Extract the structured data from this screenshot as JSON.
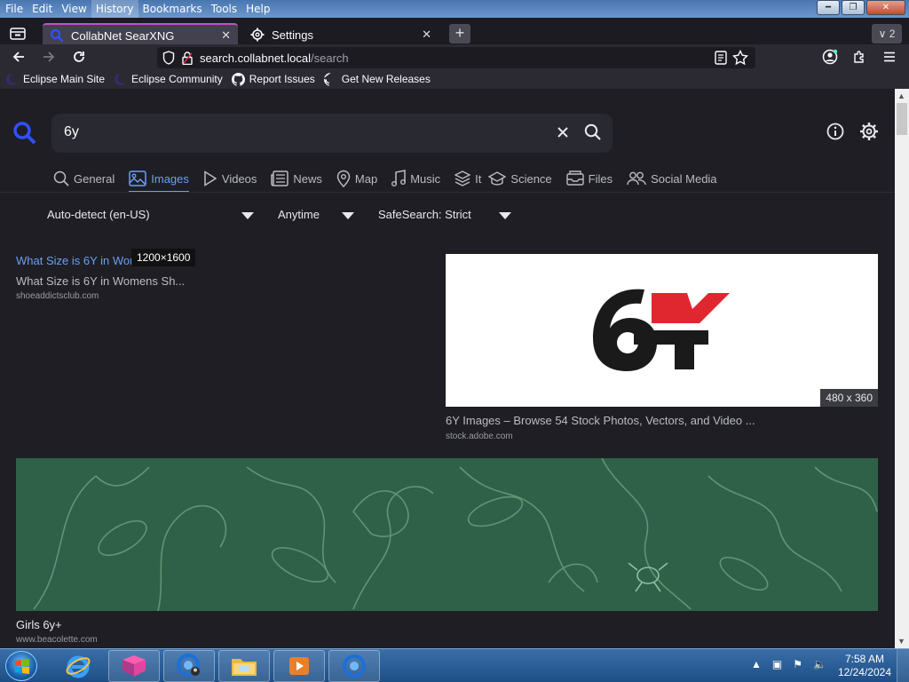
{
  "menubar": {
    "items": [
      "File",
      "Edit",
      "View",
      "History",
      "Bookmarks",
      "Tools",
      "Help"
    ],
    "active": "History"
  },
  "tabs": [
    {
      "title": "CollabNet SearXNG",
      "active": true
    },
    {
      "title": "Settings",
      "active": false
    }
  ],
  "tab_count": "2",
  "urlbar": {
    "domain": "search.collabnet.local",
    "path": "/search"
  },
  "bookmarks": [
    {
      "label": "Eclipse Main Site",
      "icon": "eclipse-icon"
    },
    {
      "label": "Eclipse Community",
      "icon": "eclipse-icon"
    },
    {
      "label": "Report Issues",
      "icon": "github-icon"
    },
    {
      "label": "Get New Releases",
      "icon": "github-icon"
    }
  ],
  "search": {
    "query": "6y"
  },
  "categories": [
    {
      "label": "General",
      "icon": "search-icon"
    },
    {
      "label": "Images",
      "icon": "image-icon",
      "active": true
    },
    {
      "label": "Videos",
      "icon": "play-icon"
    },
    {
      "label": "News",
      "icon": "newspaper-icon"
    },
    {
      "label": "Map",
      "icon": "map-pin-icon"
    },
    {
      "label": "Music",
      "icon": "music-icon"
    },
    {
      "label": "It",
      "icon": "layers-icon"
    },
    {
      "label": "Science",
      "icon": "graduation-cap-icon"
    },
    {
      "label": "Files",
      "icon": "inbox-icon"
    },
    {
      "label": "Social Media",
      "icon": "users-icon"
    }
  ],
  "filters": {
    "language": "Auto-detect (en-US)",
    "time": "Anytime",
    "safesearch": "SafeSearch: Strict"
  },
  "results": [
    {
      "title": "What Size is 6Y in Womens Sh...",
      "desc": "What Size is 6Y in Womens Sh...",
      "url": "shoeaddictsclub.com",
      "resolution": "1200×1600"
    },
    {
      "title": "6Y Images – Browse 54 Stock Photos, Vectors, and Video ...",
      "url": "stock.adobe.com",
      "resolution": "480 x 360",
      "logo_text": "6Y"
    },
    {
      "title": "Girls 6y+",
      "url": "www.beacolette.com"
    }
  ],
  "taskbar": {
    "time": "7:58 AM",
    "date": "12/24/2024"
  },
  "colors": {
    "accent": "#6b9ef7",
    "tab_highlight": "#c04fd0",
    "logo_red": "#e0262f",
    "logo_black": "#1a1a1a"
  }
}
